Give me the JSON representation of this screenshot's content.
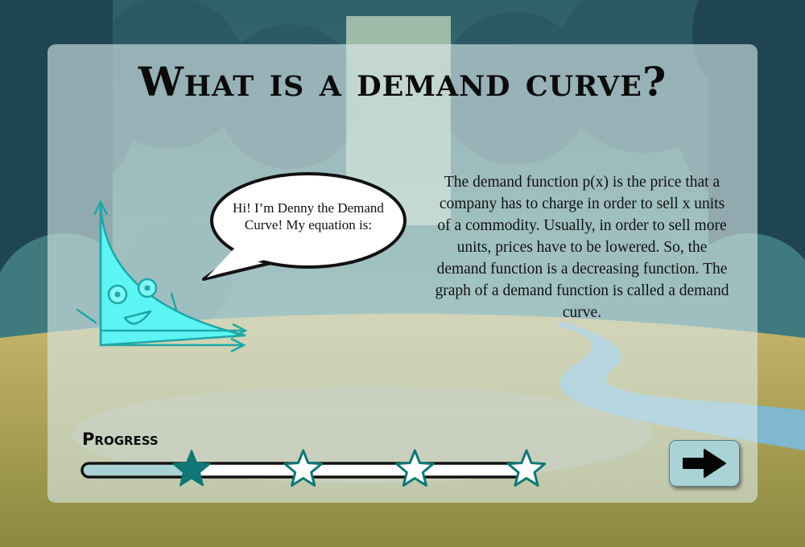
{
  "title": "What is a demand curve?",
  "character": {
    "speech": "Hi! I’m Denny the Demand Curve! My equation is:"
  },
  "description": "The demand function p(x) is the price that a company has to charge in order to sell x units of a commodity. Usually, in order to sell more units, prices have to be lowered. So, the demand function is a decreasing function. The graph of a demand function is called a demand curve.",
  "progress": {
    "label": "Progress",
    "fraction": 0.25,
    "steps_total": 4,
    "steps_completed": 1
  },
  "icons": {
    "next": "right-arrow-icon",
    "milestone": "star-icon"
  },
  "colors": {
    "accent": "#0f7775",
    "character_fill": "#5cf5f3",
    "character_stroke": "#1ea7a7",
    "track_fill": "#a9d3d6",
    "button": "#a9d3d6"
  }
}
